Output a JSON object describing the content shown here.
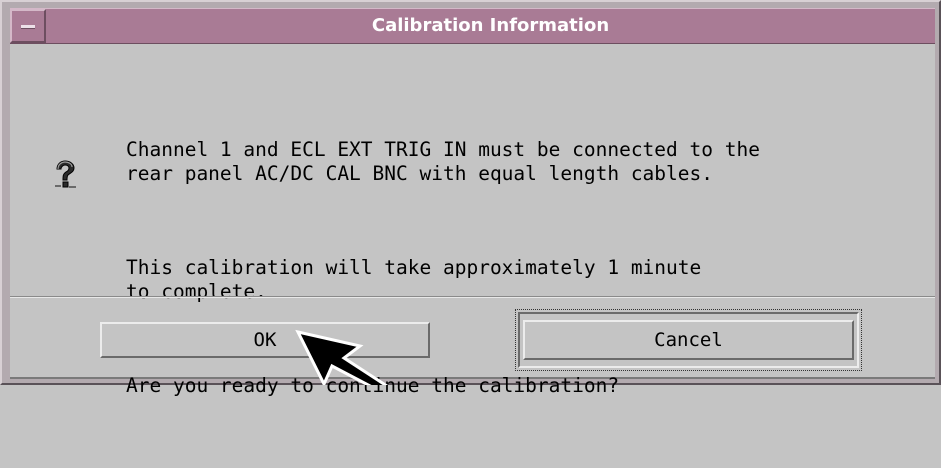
{
  "window": {
    "title": "Calibration Information",
    "colors": {
      "titlebar": "#a97b95",
      "frame": "#b3aaaf",
      "client": "#c4c4c4"
    }
  },
  "dialog": {
    "icon": "question-mark-icon",
    "message_lines": [
      "Channel 1 and ECL EXT TRIG IN must be connected to the",
      "rear panel AC/DC CAL BNC with equal length cables.",
      "This calibration will take approximately 1 minute",
      "to complete.",
      "Are you ready to continue the calibration?"
    ]
  },
  "buttons": {
    "ok_label": "OK",
    "cancel_label": "Cancel",
    "focused": "Cancel"
  },
  "cursor": {
    "icon": "arrow-cursor-icon"
  }
}
